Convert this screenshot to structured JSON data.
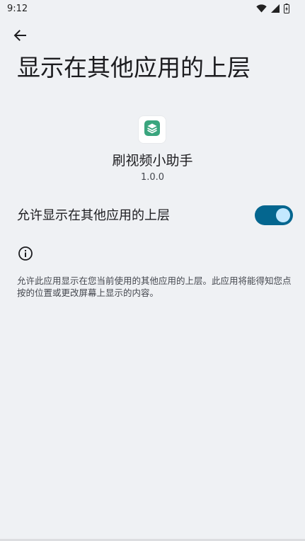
{
  "status_bar": {
    "time": "9:12",
    "icons": [
      "wifi-icon",
      "signal-icon",
      "battery-icon"
    ]
  },
  "toolbar": {
    "back_icon": "arrow-back-icon"
  },
  "page": {
    "title": "显示在其他应用的上层"
  },
  "app": {
    "icon": "app-stack-icon",
    "icon_color": "#3aa57e",
    "name": "刷视频小助手",
    "version": "1.0.0"
  },
  "setting": {
    "label": "允许显示在其他应用的上层",
    "enabled": true,
    "track_color": "#04668f",
    "thumb_color": "#c3e8ff"
  },
  "info": {
    "icon": "info-icon",
    "description": "允许此应用显示在您当前使用的其他应用的上层。此应用将能得知您点按的位置或更改屏幕上显示的内容。"
  }
}
